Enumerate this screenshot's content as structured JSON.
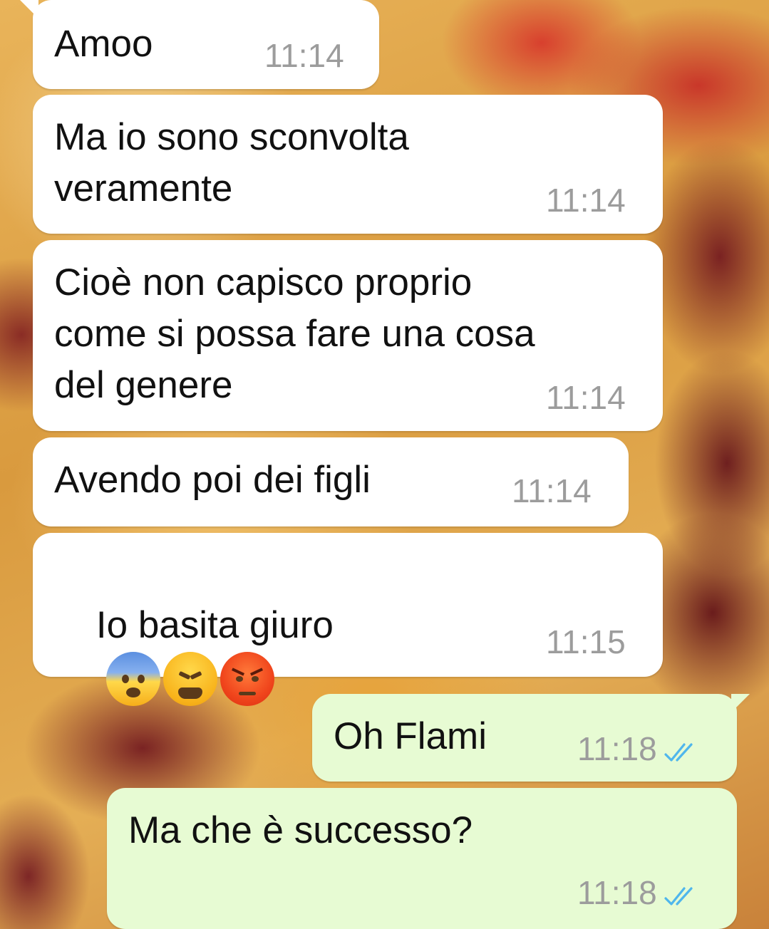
{
  "background": {
    "description_icon": "pizza-wallpaper"
  },
  "colors": {
    "incoming_bubble": "#ffffff",
    "outgoing_bubble": "#e7fbd3",
    "timestamp": "#9c9c9c",
    "read_checks": "#4fb6ec"
  },
  "messages": [
    {
      "direction": "incoming",
      "text": "Amoo",
      "time": "11:14"
    },
    {
      "direction": "incoming",
      "text": "Ma io sono sconvolta\nveramente",
      "time": "11:14"
    },
    {
      "direction": "incoming",
      "text": "Cioè non capisco proprio\ncome si possa fare una cosa\ndel genere",
      "time": "11:14"
    },
    {
      "direction": "incoming",
      "text": "Avendo poi dei figli",
      "time": "11:14"
    },
    {
      "direction": "incoming",
      "text": "Io basita giuro",
      "emojis": [
        "fearful-face-emoji",
        "tired-face-emoji",
        "angry-face-emoji"
      ],
      "time": "11:15"
    },
    {
      "direction": "outgoing",
      "text": "Oh Flami",
      "time": "11:18",
      "status": "read"
    },
    {
      "direction": "outgoing",
      "text": "Ma che è successo?",
      "time": "11:18",
      "status": "read"
    }
  ]
}
